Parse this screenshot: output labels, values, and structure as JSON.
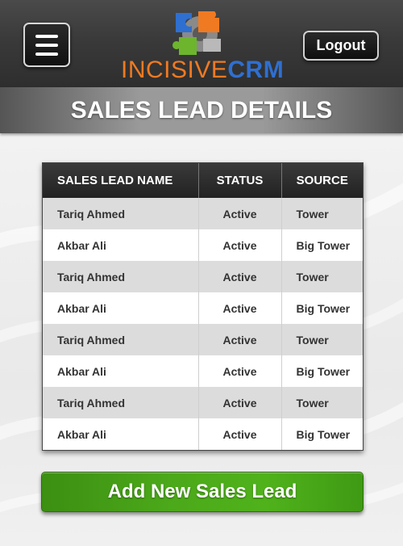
{
  "header": {
    "logo": {
      "text_part1": "INCISIVE",
      "text_part2": "CRM"
    },
    "logout_label": "Logout",
    "menu_icon": "hamburger-menu-icon"
  },
  "page": {
    "title": "SALES LEAD DETAILS"
  },
  "table": {
    "columns": [
      "SALES LEAD NAME",
      "STATUS",
      "SOURCE"
    ],
    "rows": [
      {
        "name": "Tariq Ahmed",
        "status": "Active",
        "source": "Tower"
      },
      {
        "name": "Akbar Ali",
        "status": "Active",
        "source": "Big Tower"
      },
      {
        "name": "Tariq Ahmed",
        "status": "Active",
        "source": "Tower"
      },
      {
        "name": "Akbar Ali",
        "status": "Active",
        "source": "Big Tower"
      },
      {
        "name": "Tariq Ahmed",
        "status": "Active",
        "source": "Tower"
      },
      {
        "name": "Akbar Ali",
        "status": "Active",
        "source": "Big Tower"
      },
      {
        "name": "Tariq Ahmed",
        "status": "Active",
        "source": "Tower"
      },
      {
        "name": "Akbar Ali",
        "status": "Active",
        "source": "Big Tower"
      }
    ]
  },
  "actions": {
    "add_label": "Add New Sales Lead"
  },
  "colors": {
    "header_bg": "#3a3a3a",
    "logo_orange": "#f07a22",
    "logo_blue": "#2f6fd0",
    "add_button_green": "#4ca91a",
    "row_alt": "#dcdcdc"
  }
}
